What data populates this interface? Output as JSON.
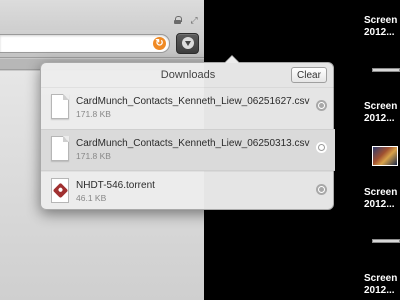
{
  "popover": {
    "title": "Downloads",
    "clear_label": "Clear",
    "items": [
      {
        "name": "CardMunch_Contacts_Kenneth_Liew_06251627.csv",
        "size": "171.8 KB"
      },
      {
        "name": "CardMunch_Contacts_Kenneth_Liew_06250313.csv",
        "size": "171.8 KB"
      },
      {
        "name": "NHDT-546.torrent",
        "size": "46.1 KB"
      }
    ]
  },
  "desktop": {
    "items": [
      {
        "line1": "Screen",
        "line2": "2012..."
      },
      {
        "line1": "Screen",
        "line2": "2012..."
      },
      {
        "line1": "Screen",
        "line2": "2012..."
      },
      {
        "line1": "Screen",
        "line2": "2012..."
      }
    ]
  },
  "icons": {
    "lock": "lock-icon",
    "fullscreen": "fullscreen-icon",
    "reload": "reload-icon",
    "downloads": "download-icon",
    "reveal": "magnifier-icon"
  },
  "colors": {
    "desktop_background": "#000000",
    "reload_accent": "#f08a24",
    "torrent_accent": "#a03030"
  }
}
